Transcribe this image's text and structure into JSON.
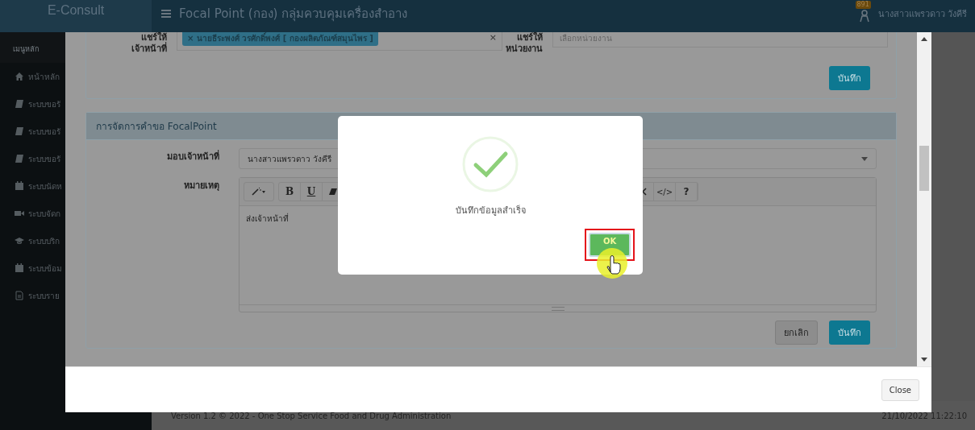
{
  "app": {
    "logo": "E-Consult",
    "page_title": "Focal Point (กอง) กลุ่มควบคุมเครื่องสำอาง",
    "notification_count": "891",
    "user_name": "นางสาวแพรวดาว วังคีรี"
  },
  "sidebar": {
    "heading": "เมนูหลัก",
    "items": [
      {
        "kind": "home",
        "label": "หน้าหลัก"
      },
      {
        "kind": "book",
        "label": "ระบบขอรั"
      },
      {
        "kind": "book",
        "label": "ระบบขอรั"
      },
      {
        "kind": "book",
        "label": "ระบบขอรั"
      },
      {
        "kind": "calendar",
        "label": "ระบบนัดห"
      },
      {
        "kind": "video",
        "label": "ระบบจัดก"
      },
      {
        "kind": "cap",
        "label": "ระบบบริก"
      },
      {
        "kind": "calendar",
        "label": "ระบบข้อม"
      },
      {
        "kind": "file",
        "label": "ระบบราย"
      }
    ]
  },
  "footer": {
    "version": "Version 1.2 © 2022 - One Stop Service Food and Drug Administration",
    "datetime": "21/10/2022 11:22:10"
  },
  "modal": {
    "share_panel": {
      "staff_label": "แชร์ให้ เจ้าหน้าที่",
      "staff_tag": "× นายธีระพงศ์ วรศักดิ์พงศ์ [ กองผลิตภัณฑ์สมุนไพร ]",
      "tag_clear": "×",
      "unit_label": "แชร์ให้ หน่วยงาน",
      "unit_placeholder": "เลือกหน่วยงาน",
      "save_button": "บันทึก"
    },
    "manage_panel": {
      "title": "การจัดการคำขอ FocalPoint",
      "assign_label": "มอบเจ้าหน้าที่",
      "assign_value": "นางสาวแพรวดาว วังคีรี",
      "note_label": "หมายเหตุ",
      "toolbar_left": [
        "B",
        "U"
      ],
      "toolbar_right": [
        "</>",
        "?"
      ],
      "note_text": "ส่งเจ้าหน้าที่",
      "cancel_button": "ยกเลิก",
      "save_button": "บันทึก"
    },
    "close_button": "Close"
  },
  "alert": {
    "message": "บันทึกข้อมูลสำเร็จ",
    "ok_button": "OK"
  }
}
